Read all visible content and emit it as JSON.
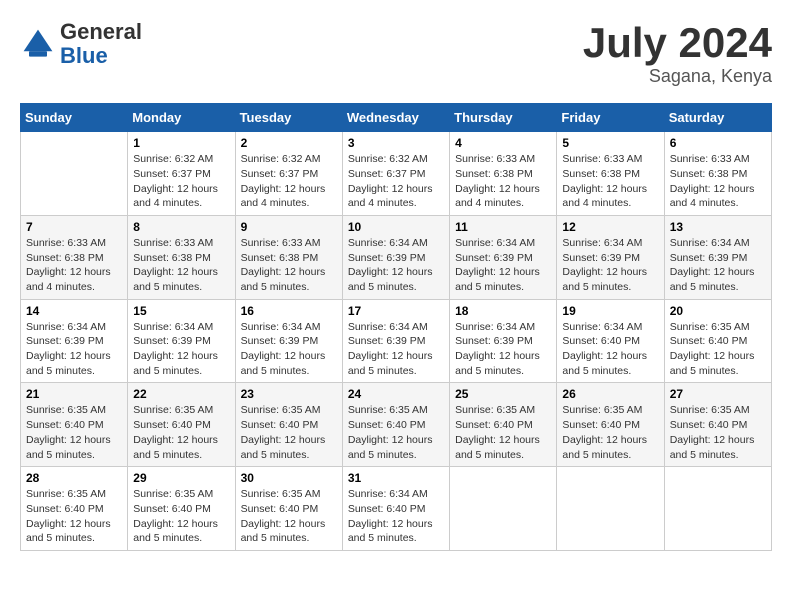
{
  "logo": {
    "general": "General",
    "blue": "Blue"
  },
  "header": {
    "month": "July 2024",
    "location": "Sagana, Kenya"
  },
  "weekdays": [
    "Sunday",
    "Monday",
    "Tuesday",
    "Wednesday",
    "Thursday",
    "Friday",
    "Saturday"
  ],
  "weeks": [
    [
      {
        "day": "",
        "info": ""
      },
      {
        "day": "1",
        "info": "Sunrise: 6:32 AM\nSunset: 6:37 PM\nDaylight: 12 hours\nand 4 minutes."
      },
      {
        "day": "2",
        "info": "Sunrise: 6:32 AM\nSunset: 6:37 PM\nDaylight: 12 hours\nand 4 minutes."
      },
      {
        "day": "3",
        "info": "Sunrise: 6:32 AM\nSunset: 6:37 PM\nDaylight: 12 hours\nand 4 minutes."
      },
      {
        "day": "4",
        "info": "Sunrise: 6:33 AM\nSunset: 6:38 PM\nDaylight: 12 hours\nand 4 minutes."
      },
      {
        "day": "5",
        "info": "Sunrise: 6:33 AM\nSunset: 6:38 PM\nDaylight: 12 hours\nand 4 minutes."
      },
      {
        "day": "6",
        "info": "Sunrise: 6:33 AM\nSunset: 6:38 PM\nDaylight: 12 hours\nand 4 minutes."
      }
    ],
    [
      {
        "day": "7",
        "info": "Sunrise: 6:33 AM\nSunset: 6:38 PM\nDaylight: 12 hours\nand 4 minutes."
      },
      {
        "day": "8",
        "info": "Sunrise: 6:33 AM\nSunset: 6:38 PM\nDaylight: 12 hours\nand 5 minutes."
      },
      {
        "day": "9",
        "info": "Sunrise: 6:33 AM\nSunset: 6:38 PM\nDaylight: 12 hours\nand 5 minutes."
      },
      {
        "day": "10",
        "info": "Sunrise: 6:34 AM\nSunset: 6:39 PM\nDaylight: 12 hours\nand 5 minutes."
      },
      {
        "day": "11",
        "info": "Sunrise: 6:34 AM\nSunset: 6:39 PM\nDaylight: 12 hours\nand 5 minutes."
      },
      {
        "day": "12",
        "info": "Sunrise: 6:34 AM\nSunset: 6:39 PM\nDaylight: 12 hours\nand 5 minutes."
      },
      {
        "day": "13",
        "info": "Sunrise: 6:34 AM\nSunset: 6:39 PM\nDaylight: 12 hours\nand 5 minutes."
      }
    ],
    [
      {
        "day": "14",
        "info": "Sunrise: 6:34 AM\nSunset: 6:39 PM\nDaylight: 12 hours\nand 5 minutes."
      },
      {
        "day": "15",
        "info": "Sunrise: 6:34 AM\nSunset: 6:39 PM\nDaylight: 12 hours\nand 5 minutes."
      },
      {
        "day": "16",
        "info": "Sunrise: 6:34 AM\nSunset: 6:39 PM\nDaylight: 12 hours\nand 5 minutes."
      },
      {
        "day": "17",
        "info": "Sunrise: 6:34 AM\nSunset: 6:39 PM\nDaylight: 12 hours\nand 5 minutes."
      },
      {
        "day": "18",
        "info": "Sunrise: 6:34 AM\nSunset: 6:39 PM\nDaylight: 12 hours\nand 5 minutes."
      },
      {
        "day": "19",
        "info": "Sunrise: 6:34 AM\nSunset: 6:40 PM\nDaylight: 12 hours\nand 5 minutes."
      },
      {
        "day": "20",
        "info": "Sunrise: 6:35 AM\nSunset: 6:40 PM\nDaylight: 12 hours\nand 5 minutes."
      }
    ],
    [
      {
        "day": "21",
        "info": "Sunrise: 6:35 AM\nSunset: 6:40 PM\nDaylight: 12 hours\nand 5 minutes."
      },
      {
        "day": "22",
        "info": "Sunrise: 6:35 AM\nSunset: 6:40 PM\nDaylight: 12 hours\nand 5 minutes."
      },
      {
        "day": "23",
        "info": "Sunrise: 6:35 AM\nSunset: 6:40 PM\nDaylight: 12 hours\nand 5 minutes."
      },
      {
        "day": "24",
        "info": "Sunrise: 6:35 AM\nSunset: 6:40 PM\nDaylight: 12 hours\nand 5 minutes."
      },
      {
        "day": "25",
        "info": "Sunrise: 6:35 AM\nSunset: 6:40 PM\nDaylight: 12 hours\nand 5 minutes."
      },
      {
        "day": "26",
        "info": "Sunrise: 6:35 AM\nSunset: 6:40 PM\nDaylight: 12 hours\nand 5 minutes."
      },
      {
        "day": "27",
        "info": "Sunrise: 6:35 AM\nSunset: 6:40 PM\nDaylight: 12 hours\nand 5 minutes."
      }
    ],
    [
      {
        "day": "28",
        "info": "Sunrise: 6:35 AM\nSunset: 6:40 PM\nDaylight: 12 hours\nand 5 minutes."
      },
      {
        "day": "29",
        "info": "Sunrise: 6:35 AM\nSunset: 6:40 PM\nDaylight: 12 hours\nand 5 minutes."
      },
      {
        "day": "30",
        "info": "Sunrise: 6:35 AM\nSunset: 6:40 PM\nDaylight: 12 hours\nand 5 minutes."
      },
      {
        "day": "31",
        "info": "Sunrise: 6:34 AM\nSunset: 6:40 PM\nDaylight: 12 hours\nand 5 minutes."
      },
      {
        "day": "",
        "info": ""
      },
      {
        "day": "",
        "info": ""
      },
      {
        "day": "",
        "info": ""
      }
    ]
  ]
}
